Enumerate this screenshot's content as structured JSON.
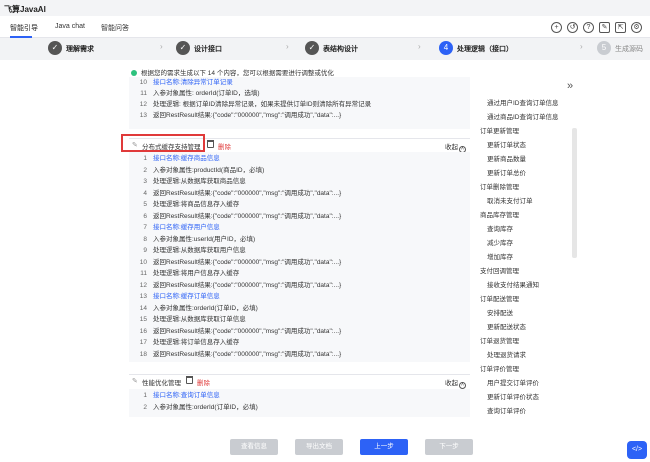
{
  "window": {
    "title": "飞算JavaAI"
  },
  "tabs": [
    "智能引导",
    "Java chat",
    "智能问答"
  ],
  "steps": [
    {
      "num": "✓",
      "label": "理解需求"
    },
    {
      "num": "✓",
      "label": "设计接口"
    },
    {
      "num": "✓",
      "label": "表结构设计"
    },
    {
      "num": "4",
      "label": "处理逻辑（接口）"
    },
    {
      "num": "5",
      "label": "生成源码"
    }
  ],
  "info": "根据您的需求生成以下 14 个内容，您可以根据需要进行调整或优化",
  "top_lines": [
    {
      "n": "10",
      "t": "接口名称:清除异常订单记录",
      "blue": true
    },
    {
      "n": "11",
      "t": "入参对象属性: orderId(订单ID，选填)",
      "blue": false
    },
    {
      "n": "12",
      "t": "处理逻辑: 根据订单ID清除异常记录，如果未提供订单ID则清除所有异常记录",
      "blue": false
    },
    {
      "n": "13",
      "t": "返回RestResult结果:{\"code\":\"000000\",\"msg\":\"调用成功\",\"data\":...}",
      "blue": false
    }
  ],
  "sections": [
    {
      "title": "分布式缓存支持管理",
      "delete": "删除",
      "collapse": "收起",
      "lines": [
        {
          "n": "1",
          "t": "接口名称:缓存商品信息",
          "blue": true
        },
        {
          "n": "2",
          "t": "入参对象属性:productId(商品ID，必填)",
          "blue": false
        },
        {
          "n": "3",
          "t": "处理逻辑:从数据库获取商品信息",
          "blue": false
        },
        {
          "n": "4",
          "t": "返回RestResult结果:{\"code\":\"000000\",\"msg\":\"调用成功\",\"data\":...}",
          "blue": false
        },
        {
          "n": "5",
          "t": "处理逻辑:将商品信息存入缓存",
          "blue": false
        },
        {
          "n": "6",
          "t": "返回RestResult结果:{\"code\":\"000000\",\"msg\":\"调用成功\",\"data\":...}",
          "blue": false
        },
        {
          "n": "7",
          "t": "接口名称:缓存用户信息",
          "blue": true
        },
        {
          "n": "8",
          "t": "入参对象属性:userId(用户ID，必填)",
          "blue": false
        },
        {
          "n": "9",
          "t": "处理逻辑:从数据库获取用户信息",
          "blue": false
        },
        {
          "n": "10",
          "t": "返回RestResult结果:{\"code\":\"000000\",\"msg\":\"调用成功\",\"data\":...}",
          "blue": false
        },
        {
          "n": "11",
          "t": "处理逻辑:将用户信息存入缓存",
          "blue": false
        },
        {
          "n": "12",
          "t": "返回RestResult结果:{\"code\":\"000000\",\"msg\":\"调用成功\",\"data\":...}",
          "blue": false
        },
        {
          "n": "13",
          "t": "接口名称:缓存订单信息",
          "blue": true
        },
        {
          "n": "14",
          "t": "入参对象属性:orderId(订单ID，必填)",
          "blue": false
        },
        {
          "n": "15",
          "t": "处理逻辑:从数据库获取订单信息",
          "blue": false
        },
        {
          "n": "16",
          "t": "返回RestResult结果:{\"code\":\"000000\",\"msg\":\"调用成功\",\"data\":...}",
          "blue": false
        },
        {
          "n": "17",
          "t": "处理逻辑:将订单信息存入缓存",
          "blue": false
        },
        {
          "n": "18",
          "t": "返回RestResult结果:{\"code\":\"000000\",\"msg\":\"调用成功\",\"data\":...}",
          "blue": false
        }
      ]
    },
    {
      "title": "性能优化管理",
      "delete": "删除",
      "collapse": "收起",
      "lines": [
        {
          "n": "1",
          "t": "接口名称:查询订单信息",
          "blue": true
        },
        {
          "n": "2",
          "t": "入参对象属性:orderId(订单ID，必填)",
          "blue": false
        }
      ]
    }
  ],
  "outline": [
    {
      "t": "通过用户ID查询订单信息",
      "level": 2
    },
    {
      "t": "通过商品ID查询订单信息",
      "level": 2
    },
    {
      "t": "订单更新管理",
      "level": 1
    },
    {
      "t": "更新订单状态",
      "level": 2
    },
    {
      "t": "更新商品数量",
      "level": 2
    },
    {
      "t": "更新订单总价",
      "level": 2
    },
    {
      "t": "订单删除管理",
      "level": 1
    },
    {
      "t": "取消未支付订单",
      "level": 2
    },
    {
      "t": "商品库存管理",
      "level": 1
    },
    {
      "t": "查询库存",
      "level": 2
    },
    {
      "t": "减少库存",
      "level": 2
    },
    {
      "t": "增加库存",
      "level": 2
    },
    {
      "t": "支付回调管理",
      "level": 1
    },
    {
      "t": "接收支付结果通知",
      "level": 2
    },
    {
      "t": "订单配送管理",
      "level": 1
    },
    {
      "t": "安排配送",
      "level": 2
    },
    {
      "t": "更新配送状态",
      "level": 2
    },
    {
      "t": "订单退货管理",
      "level": 1
    },
    {
      "t": "处理退货请求",
      "level": 2
    },
    {
      "t": "订单评价管理",
      "level": 1
    },
    {
      "t": "用户提交订单评价",
      "level": 2
    },
    {
      "t": "更新订单评价状态",
      "level": 2
    },
    {
      "t": "查询订单评价",
      "level": 2
    }
  ],
  "buttons": {
    "view_source": "查看信息",
    "export_doc": "导出文档",
    "prev": "上一步",
    "next": "下一步"
  },
  "float_button": "</>"
}
